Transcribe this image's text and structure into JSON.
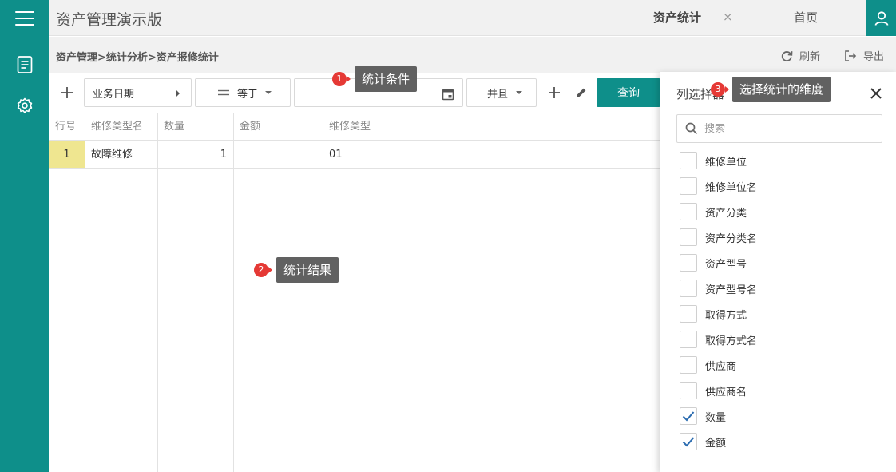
{
  "app": {
    "title": "资产管理演示版"
  },
  "tabs": {
    "active_label": "资产统计",
    "close_glyph": "×",
    "home_label": "首页"
  },
  "breadcrumb": "资产管理>统计分析>资产报修统计",
  "toolbar": {
    "refresh_label": "刷新",
    "export_label": "导出"
  },
  "filter": {
    "field_value": "业务日期",
    "operator_value": "等于",
    "date_value": "",
    "logic_value": "并且",
    "query_label": "查询"
  },
  "table": {
    "headers": [
      "行号",
      "维修类型名",
      "数量",
      "金额",
      "维修类型"
    ],
    "rows": [
      {
        "rownum": "1",
        "type_name": "故障维修",
        "quantity": "1",
        "amount": "",
        "type_code": "01"
      }
    ]
  },
  "column_panel": {
    "title": "列选择器",
    "search_placeholder": "搜索",
    "options": [
      {
        "label": "维修单位",
        "checked": false
      },
      {
        "label": "维修单位名",
        "checked": false
      },
      {
        "label": "资产分类",
        "checked": false
      },
      {
        "label": "资产分类名",
        "checked": false
      },
      {
        "label": "资产型号",
        "checked": false
      },
      {
        "label": "资产型号名",
        "checked": false
      },
      {
        "label": "取得方式",
        "checked": false
      },
      {
        "label": "取得方式名",
        "checked": false
      },
      {
        "label": "供应商",
        "checked": false
      },
      {
        "label": "供应商名",
        "checked": false
      },
      {
        "label": "数量",
        "checked": true
      },
      {
        "label": "金额",
        "checked": true
      }
    ]
  },
  "callouts": [
    {
      "number": "1",
      "text": "统计条件"
    },
    {
      "number": "2",
      "text": "统计结果"
    },
    {
      "number": "3",
      "text": "选择统计的维度"
    }
  ],
  "colors": {
    "accent": "#0e8f8a",
    "highlight": "#efe690",
    "badge": "#e53935",
    "tooltip": "#616161",
    "check": "#2b6cb0"
  }
}
